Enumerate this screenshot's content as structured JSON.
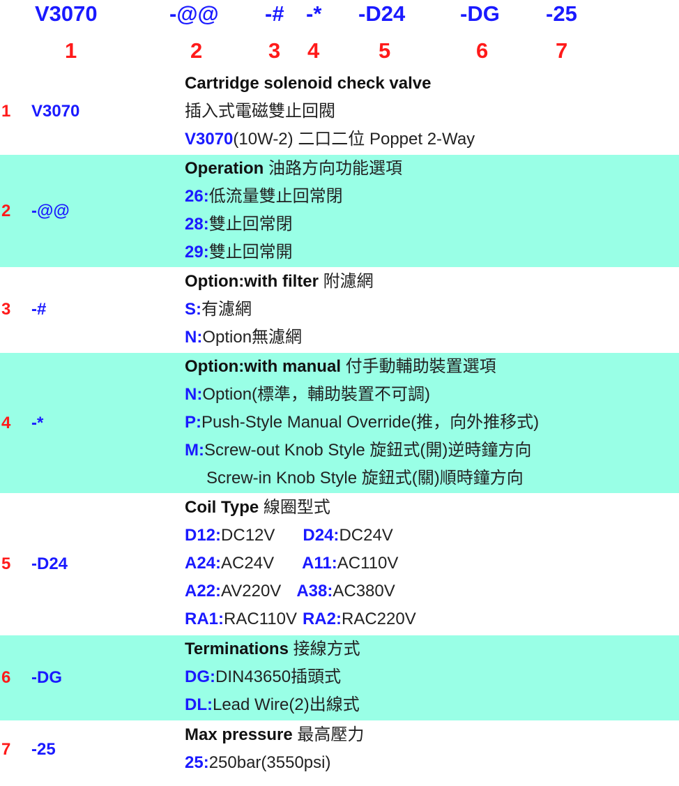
{
  "header": {
    "codes": [
      "V3070",
      "-@@",
      "-#",
      "-*",
      "-D24",
      "-DG",
      "-25"
    ],
    "numbers": [
      "1",
      "2",
      "3",
      "4",
      "5",
      "6",
      "7"
    ]
  },
  "rows": [
    {
      "num": "1",
      "code": "V3070",
      "title": "Cartridge solenoid check valve",
      "line2": "插入式電磁雙止回閥",
      "l3k": "V3070",
      "l3t": "(10W-2)  二口二位 Poppet 2-Way"
    },
    {
      "num": "2",
      "code": "-@@",
      "title": "Operation",
      "title_zh": " 油路方向功能選項",
      "opts": [
        {
          "k": "26:",
          "t": "低流量雙止回常閉"
        },
        {
          "k": "28:",
          "t": "雙止回常閉"
        },
        {
          "k": "29:",
          "t": "雙止回常開"
        }
      ]
    },
    {
      "num": "3",
      "code": "-#",
      "title": "Option:with filter",
      "title_zh": " 附濾網",
      "opts": [
        {
          "k": "S:",
          "t": "有濾網"
        },
        {
          "k": "N:",
          "t": "Option無濾網"
        }
      ]
    },
    {
      "num": "4",
      "code": "-*",
      "title": "Option:with manual",
      "title_zh": " 付手動輔助裝置選項",
      "opts": [
        {
          "k": "N:",
          "t": "Option(標準，輔助裝置不可調)"
        },
        {
          "k": "P:",
          "t": "Push-Style Manual Override(推，向外推移式)"
        },
        {
          "k": "M:",
          "t": "Screw-out Knob Style 旋鈕式(開)逆時鐘方向"
        }
      ],
      "extra": "Screw-in Knob Style 旋鈕式(關)順時鐘方向"
    },
    {
      "num": "5",
      "code": "-D24",
      "title": "Coil Type",
      "title_zh": " 線圈型式",
      "pairs": [
        {
          "k1": "D12:",
          "t1": "DC12V",
          "k2": "D24:",
          "t2": "DC24V"
        },
        {
          "k1": "A24:",
          "t1": "AC24V",
          "k2": "A11:",
          "t2": "AC110V"
        },
        {
          "k1": "A22:",
          "t1": "AV220V",
          "k2": "A38:",
          "t2": "AC380V"
        },
        {
          "k1": "RA1:",
          "t1": "RAC110V",
          "k2": "RA2:",
          "t2": "RAC220V"
        }
      ]
    },
    {
      "num": "6",
      "code": "-DG",
      "title": "Terminations",
      "title_zh": " 接線方式",
      "opts": [
        {
          "k": "DG:",
          "t": "DIN43650插頭式"
        },
        {
          "k": "DL:",
          "t": "Lead Wire(2)出線式"
        }
      ]
    },
    {
      "num": "7",
      "code": "-25",
      "title": "Max pressure",
      "title_zh": " 最高壓力",
      "opts": [
        {
          "k": "25:",
          "t": "250bar(3550psi)"
        }
      ]
    }
  ]
}
